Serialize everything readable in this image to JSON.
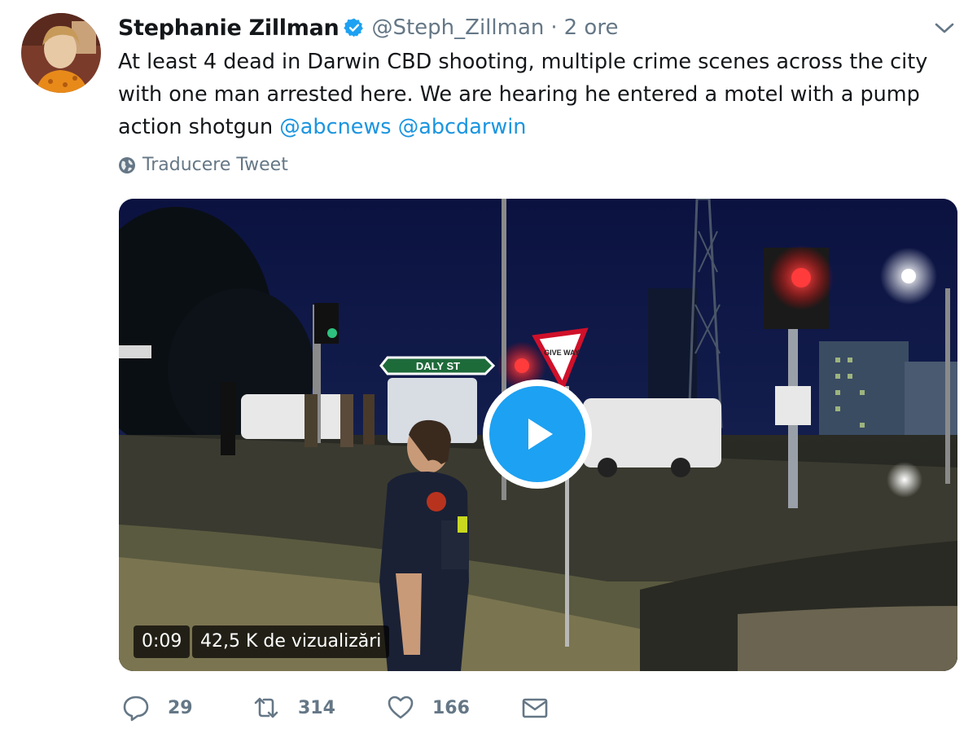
{
  "tweet": {
    "display_name": "Stephanie Zillman",
    "handle": "@Steph_Zillman",
    "separator": "·",
    "time": "2 ore",
    "text_plain": "At least 4 dead in Darwin CBD shooting, multiple crime scenes across the city with one man arrested here. We are hearing he entered a motel with a pump action shotgun ",
    "mention_1": "@abcnews",
    "mention_2": "@abcdarwin",
    "translate_label": "Traducere Tweet",
    "icons": {
      "verified": "verified-badge-icon",
      "caret": "chevron-down-icon",
      "translate": "globe-icon"
    }
  },
  "media": {
    "type": "video",
    "duration": "0:09",
    "views": "42,5 K de vizualizări",
    "play_icon": "play-icon",
    "street_sign": "DALY ST",
    "yield_sign": "GIVE WAY"
  },
  "actions": {
    "reply_count": "29",
    "retweet_count": "314",
    "like_count": "166",
    "icons": [
      "reply-icon",
      "retweet-icon",
      "like-icon",
      "direct-message-icon"
    ]
  },
  "colors": {
    "accent": "#1da1f2",
    "mention": "#1b95e0",
    "secondary_text": "#657786",
    "primary_text": "#14171a"
  }
}
